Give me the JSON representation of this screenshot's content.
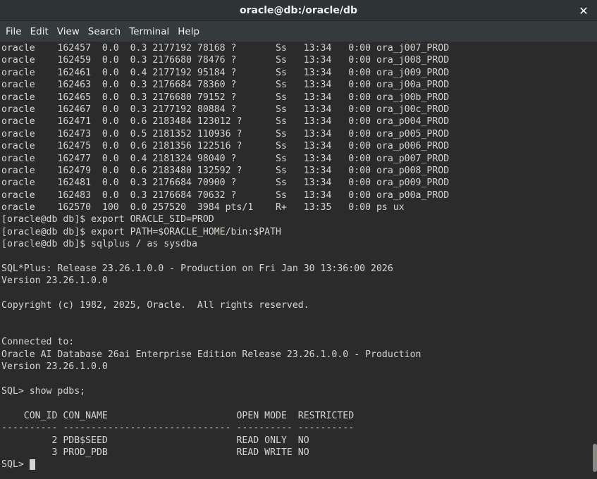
{
  "window": {
    "title": "oracle@db:/oracle/db",
    "close_glyph": "✕"
  },
  "menu": {
    "items": [
      "File",
      "Edit",
      "View",
      "Search",
      "Terminal",
      "Help"
    ]
  },
  "terminal": {
    "lines": [
      "oracle    162457  0.0  0.3 2177192 78168 ?       Ss   13:34   0:00 ora_j007_PROD",
      "oracle    162459  0.0  0.3 2176680 78476 ?       Ss   13:34   0:00 ora_j008_PROD",
      "oracle    162461  0.0  0.4 2177192 95184 ?       Ss   13:34   0:00 ora_j009_PROD",
      "oracle    162463  0.0  0.3 2176684 78360 ?       Ss   13:34   0:00 ora_j00a_PROD",
      "oracle    162465  0.0  0.3 2176680 79152 ?       Ss   13:34   0:00 ora_j00b_PROD",
      "oracle    162467  0.0  0.3 2177192 80884 ?       Ss   13:34   0:00 ora_j00c_PROD",
      "oracle    162471  0.0  0.6 2183484 123012 ?      Ss   13:34   0:00 ora_p004_PROD",
      "oracle    162473  0.0  0.5 2181352 110936 ?      Ss   13:34   0:00 ora_p005_PROD",
      "oracle    162475  0.0  0.6 2181356 122516 ?      Ss   13:34   0:00 ora_p006_PROD",
      "oracle    162477  0.0  0.4 2181324 98040 ?       Ss   13:34   0:00 ora_p007_PROD",
      "oracle    162479  0.0  0.6 2183480 132592 ?      Ss   13:34   0:00 ora_p008_PROD",
      "oracle    162481  0.0  0.3 2176684 70900 ?       Ss   13:34   0:00 ora_p009_PROD",
      "oracle    162483  0.0  0.3 2176684 70632 ?       Ss   13:34   0:00 ora_p00a_PROD",
      "oracle    162570  100  0.0 257520  3984 pts/1    R+   13:35   0:00 ps ux",
      "[oracle@db db]$ export ORACLE_SID=PROD",
      "[oracle@db db]$ export PATH=$ORACLE_HOME/bin:$PATH",
      "[oracle@db db]$ sqlplus / as sysdba",
      "",
      "SQL*Plus: Release 23.26.1.0.0 - Production on Fri Jan 30 13:36:00 2026",
      "Version 23.26.1.0.0",
      "",
      "Copyright (c) 1982, 2025, Oracle.  All rights reserved.",
      "",
      "",
      "Connected to:",
      "Oracle AI Database 26ai Enterprise Edition Release 23.26.1.0.0 - Production",
      "Version 23.26.1.0.0",
      "",
      "SQL> show pdbs;",
      "",
      "    CON_ID CON_NAME                       OPEN MODE  RESTRICTED",
      "---------- ------------------------------ ---------- ----------",
      "         2 PDB$SEED                       READ ONLY  NO",
      "         3 PROD_PDB                       READ WRITE NO"
    ],
    "prompt": "SQL> "
  },
  "colors": {
    "background": "#2b2b2b",
    "foreground": "#d3d7cf",
    "titlebar": "#2e3436",
    "menubar": "#353b3d"
  }
}
